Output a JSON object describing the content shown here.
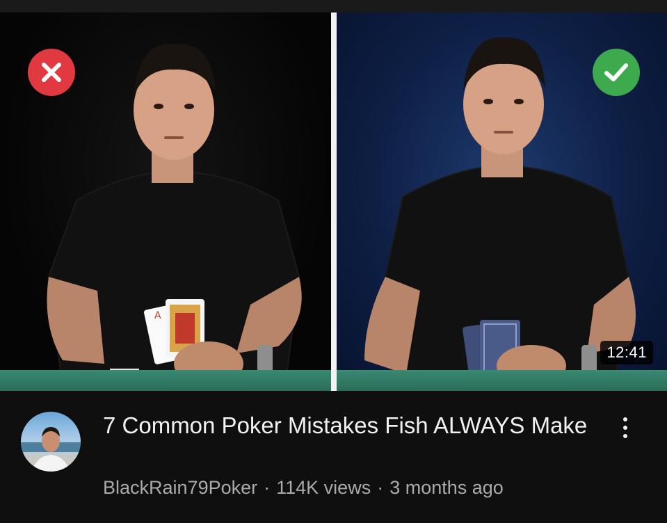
{
  "video": {
    "duration": "12:41",
    "title": "7 Common Poker Mistakes Fish ALWAYS Make",
    "channel": "BlackRain79Poker",
    "views": "114K views",
    "age": "3 months ago",
    "separator": "·"
  },
  "thumbnail": {
    "left_badge_icon": "x-mark-icon",
    "right_badge_icon": "check-mark-icon",
    "colors": {
      "wrong_badge": "#e0393f",
      "right_badge": "#3daa4d",
      "felt": "#2f7a63",
      "right_background": "#13295a"
    }
  },
  "menu": {
    "icon": "more-vertical-icon"
  }
}
